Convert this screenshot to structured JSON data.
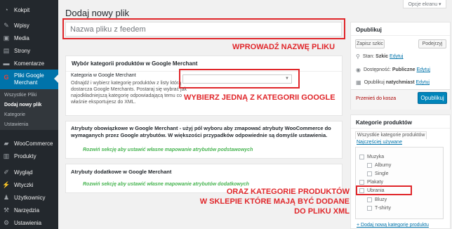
{
  "sidebar": {
    "items": [
      {
        "icon": "dashboard-icon",
        "label": "Kokpit"
      },
      {
        "icon": "pin-icon",
        "label": "Wpisy"
      },
      {
        "icon": "media-icon",
        "label": "Media"
      },
      {
        "icon": "pages-icon",
        "label": "Strony"
      },
      {
        "icon": "comments-icon",
        "label": "Komentarze"
      },
      {
        "icon": "google-icon",
        "label": "Pliki Google Merchant"
      },
      {
        "icon": "woocommerce-icon",
        "label": "WooCommerce"
      },
      {
        "icon": "products-icon",
        "label": "Produkty"
      },
      {
        "icon": "appearance-icon",
        "label": "Wygląd"
      },
      {
        "icon": "plugins-icon",
        "label": "Wtyczki"
      },
      {
        "icon": "users-icon",
        "label": "Użytkownicy"
      },
      {
        "icon": "tools-icon",
        "label": "Narzędzia"
      },
      {
        "icon": "settings-icon",
        "label": "Ustawienia"
      }
    ],
    "current_label_line1": "Pliki Google",
    "current_label_line2": "Merchant",
    "submenu": [
      "Wszystkie Pliki",
      "Dodaj nowy plik",
      "Kategorie",
      "Ustawienia"
    ]
  },
  "header": {
    "screen_options": "Opcje ekranu ▾",
    "page_title": "Dodaj nowy plik"
  },
  "title_field": {
    "placeholder": "Nazwa pliku z feedem"
  },
  "annotations": {
    "enter_name": "WPROWADŹ NAZWĘ PLIKU",
    "choose_category": "WYBIERZ JEDNĄ Z KATEGORII GOOGLE",
    "product_cats_1": "ORAZ KATEGORIE PRODUKTÓW",
    "product_cats_2": "W SKLEPIE KTÓRE MAJĄ BYĆ DODANE",
    "product_cats_3": "DO PLIKU XML"
  },
  "category_box": {
    "title": "Wybór kategorii produktów w Google Merchant",
    "field_label": "Kategoria w Google Merchant",
    "description_lines": [
      "Odnajdź i wybierz kategorię produktów z listy którą",
      "dostarcza Google Merchants. Postaraj się wybrać jak",
      "najodkładniejszą kategorię odpowiadającą temu co",
      "właśnie eksportujesz do XML."
    ],
    "selected_value": ""
  },
  "required_attrs_box": {
    "title_line1": "Atrybuty obowiązkowe w Google Merchant - użyj pól wyboru aby zmapować atrybuty WooCommerce do",
    "title_line2": "wymaganych przez Google atrybutów. W większości przypadków odpowiednie są domyśle ustawienia.",
    "expand_text": "Rozwiń sekcję aby ustawić własne mapowanie atrybutów podstawowych"
  },
  "additional_attrs_box": {
    "title": "Atrybuty dodatkowe w Google Merchant",
    "expand_text": "Rozwiń sekcję aby ustawić własne mapowanie atrybutów dodatkowych"
  },
  "publish_box": {
    "title": "Opublikuj",
    "save_draft": "Zapisz szkic",
    "preview": "Podejrzyj",
    "status_label": "Stan:",
    "status_value": "Szkic",
    "visibility_label": "Dostępność:",
    "visibility_value": "Publiczne",
    "publish_label": "Opublikuj",
    "publish_value": "natychmiast",
    "edit": "Edytuj",
    "trash": "Przenieś do kosza",
    "publish_button": "Opublikuj"
  },
  "product_cats_box": {
    "title": "Kategorie produktów",
    "tab_all": "Wszystkie kategorie produktów",
    "tab_popular": "Najczęściej używane",
    "items": [
      {
        "label": "Muzyka",
        "level": 0
      },
      {
        "label": "Albumy",
        "level": 1
      },
      {
        "label": "Single",
        "level": 1
      },
      {
        "label": "Plakaty",
        "level": 0
      },
      {
        "label": "Ubrania",
        "level": 0
      },
      {
        "label": "Bluzy",
        "level": 1
      },
      {
        "label": "T-shirty",
        "level": 1
      }
    ],
    "add_new": "+ Dodaj nową kategorię produktu"
  },
  "colors": {
    "sidebar_bg": "#23282d",
    "accent": "#0073aa",
    "annotation_red": "#e0262a",
    "green": "#46b450"
  }
}
